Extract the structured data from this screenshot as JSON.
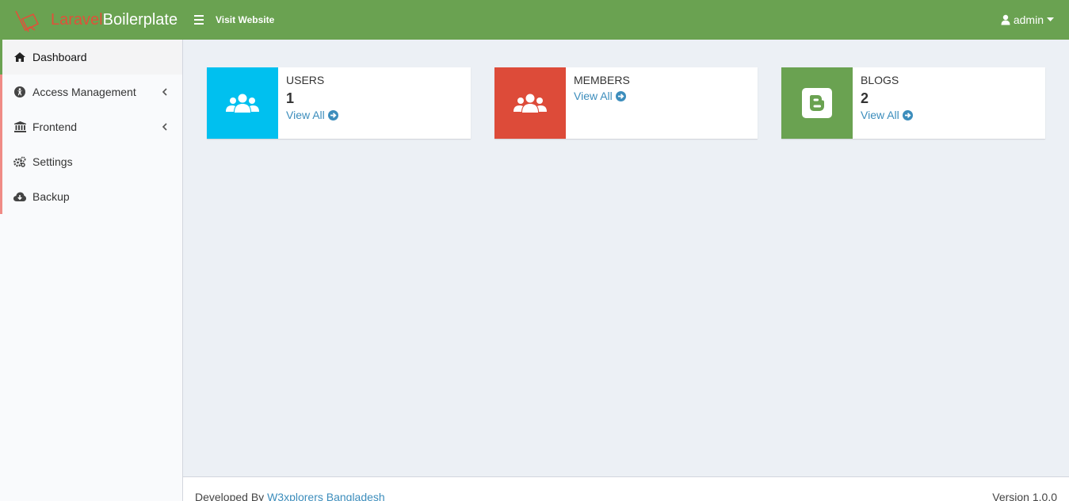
{
  "brand": {
    "part1": "Laravel",
    "part2": "Boilerplate",
    "color_part1": "#e0513a",
    "color_header": "#6aa251"
  },
  "header": {
    "visit_label": "Visit Website",
    "user_name": "admin",
    "user_icon": "user-icon",
    "menu_icon": "hamburger-icon"
  },
  "sidebar": {
    "items": [
      {
        "label": "Dashboard",
        "icon": "home-icon",
        "active": true
      },
      {
        "label": "Access Management",
        "icon": "universal-access-icon",
        "has_submenu": true
      },
      {
        "label": "Frontend",
        "icon": "institution-icon",
        "has_submenu": true
      },
      {
        "label": "Settings",
        "icon": "cogs-icon"
      },
      {
        "label": "Backup",
        "icon": "cloud-download-icon"
      }
    ]
  },
  "boxes": [
    {
      "title": "USERS",
      "count": "1",
      "link": "View All",
      "icon": "users-icon",
      "color": "#00c0ef"
    },
    {
      "title": "MEMBERS",
      "count": "",
      "link": "View All",
      "icon": "users-icon",
      "color": "#dd4b39"
    },
    {
      "title": "BLOGS",
      "count": "2",
      "link": "View All",
      "icon": "blogger-icon",
      "color": "#6aa251"
    }
  ],
  "footer": {
    "developed_by": "Developed By",
    "company": "W3xplorers Bangladesh",
    "version": "Version 1.0.0"
  }
}
